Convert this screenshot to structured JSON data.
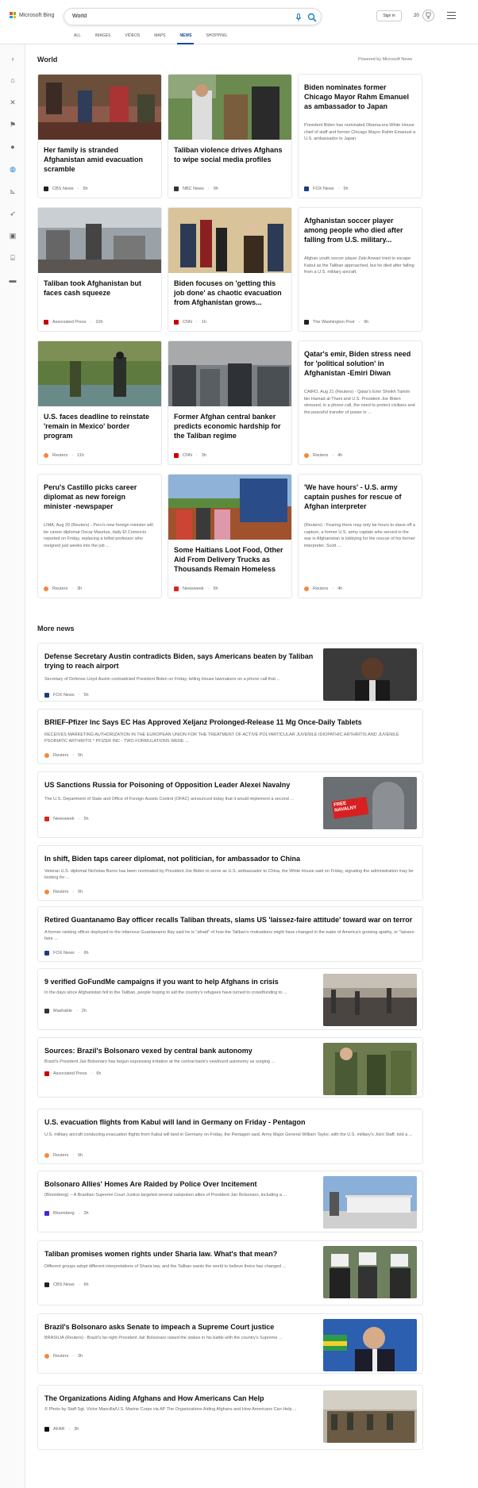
{
  "header": {
    "brand": "Microsoft Bing",
    "search_value": "World",
    "signin_label": "Sign in",
    "points": "20"
  },
  "tabs": [
    {
      "label": "ALL"
    },
    {
      "label": "IMAGES"
    },
    {
      "label": "VIDEOS"
    },
    {
      "label": "MAPS"
    },
    {
      "label": "NEWS"
    },
    {
      "label": "SHOPPING"
    }
  ],
  "sidebar": {
    "icons": [
      "chevron-right-icon",
      "home-icon",
      "tools-icon",
      "flag-icon",
      "location-icon",
      "globe-icon",
      "chart-icon",
      "rocket-icon",
      "film-icon",
      "education-icon",
      "car-icon"
    ]
  },
  "section": {
    "title": "World",
    "powered_by": "Powered by Microsoft News",
    "more_title": "More news"
  },
  "cards": [
    {
      "title": "Her family is stranded Afghanistan amid evacuation scramble",
      "source": "CBS News",
      "time": "5h",
      "desc": ""
    },
    {
      "title": "Taliban violence drives Afghans to wipe social media profiles",
      "source": "NBC News",
      "time": "9h",
      "desc": ""
    },
    {
      "title": "Biden nominates former Chicago Mayor Rahm Emanuel as ambassador to Japan",
      "source": "FOX News",
      "time": "5h",
      "desc": "President Biden has nominated Obama-era White House chief of staff and former Chicago Mayor Rahm Emanuel a U.S. ambassador to Japan."
    },
    {
      "title": "Taliban took Afghanistan but faces cash squeeze",
      "source": "Associated Press",
      "time": "10h",
      "desc": ""
    },
    {
      "title": "Biden focuses on 'getting this job done' as chaotic evacuation from Afghanistan grows...",
      "source": "CNN",
      "time": "1h",
      "desc": ""
    },
    {
      "title": "Afghanistan soccer player among people who died after falling from U.S. military...",
      "source": "The Washington Post",
      "time": "9h",
      "desc": "Afghan youth soccer player Zaki Anwari tried to escape Kabul as the Taliban approached, but he died after falling from a U.S. military aircraft."
    },
    {
      "title": "U.S. faces deadline to reinstate 'remain in Mexico' border program",
      "source": "Reuters",
      "time": "11h",
      "desc": ""
    },
    {
      "title": "Former Afghan central banker predicts economic hardship for the Taliban regime",
      "source": "CNN",
      "time": "3h",
      "desc": ""
    },
    {
      "title": "Qatar's emir, Biden stress need for 'political solution' in Afghanistan -Emiri Diwan",
      "source": "Reuters",
      "time": "4h",
      "desc": "CAIRO, Aug 21 (Reuters) - Qatar's Emir Sheikh Tamim bin Hamad al-Thani and U.S. President Joe Biden stressed, in a phone call, the need to protect civilians and the peaceful transfer of power in ..."
    },
    {
      "title": "Peru's Castillo picks career diplomat as new foreign minister -newspaper",
      "source": "Reuters",
      "time": "3h",
      "desc": "LIMA, Aug 20 (Reuters) - Peru's new foreign minister will be career diplomat Oscar Maurtua, daily El Comercio reported on Friday, replacing a leftist professor who resigned just weeks into the job ..."
    },
    {
      "title": "Some Haitians Loot Food, Other Aid From Delivery Trucks as Thousands Remain Homeless",
      "source": "Newsweek",
      "time": "5h",
      "desc": ""
    },
    {
      "title": "'We have hours' - U.S. army captain pushes for rescue of Afghan interpreter",
      "source": "Reuters",
      "time": "4h",
      "desc": "(Reuters) - Fearing there may only be hours to stave off a capture, a former U.S. army captain who served in the war in Afghanistan is lobbying for the rescue of his former interpreter.     Scott ..."
    }
  ],
  "more_news": [
    {
      "title": "Defense Secretary Austin contradicts Biden, says Americans beaten by Taliban trying to reach airport",
      "desc": "Secretary of Defense Lloyd Austin contradicted President Biden on Friday, telling House lawmakers on a phone call that ...",
      "source": "FOX News",
      "time": "5h"
    },
    {
      "title": "BRIEF-Pfizer Inc Says EC Has Approved Xeljanz Prolonged-Release 11 Mg Once-Daily Tablets",
      "desc": "RECEIVES MARKETING AUTHORIZATION IN THE EUROPEAN UNION FOR THE TREATMENT OF ACTIVE POLYARTICULAR JUVENILE IDIOPATHIC ARTHRITIS AND JUVENILE PSORIATIC ARTHRITIS * PFIZER INC - TWO FORMULATIONS WERE ...",
      "source": "Reuters",
      "time": "5h"
    },
    {
      "title": "US Sanctions Russia for Poisoning of Opposition Leader Alexei Navalny",
      "desc": "The U.S. Department of State and Office of Foreign Assets Control (OFAC) announced today that it would implement a second ...",
      "source": "Newsweek",
      "time": "5h",
      "thumb_text": "FREE NAVALNY"
    },
    {
      "title": "In shift, Biden taps career diplomat, not politician, for ambassador to China",
      "desc": "Veteran U.S. diplomat Nicholas Burns has been nominated by President Joe Biden to serve as U.S. ambassador to China, the White House said on Friday, signaling the administration may be looking for ...",
      "source": "Reuters",
      "time": "6h"
    },
    {
      "title": "Retired Guantanamo Bay officer recalls Taliban threats, slams US 'laissez-faire attitude' toward war on terror",
      "desc": "A former ranking officer deployed to the infamous Guantanamo Bay said he is \"afraid\" of how the Taliban's motivations might have changed in the wake of America's growing apathy, or \"laissez-faire ...",
      "source": "FOX News",
      "time": "6h"
    },
    {
      "title": "9 verified GoFundMe campaigns if you want to help Afghans in crisis",
      "desc": "In the days since Afghanistan fell to the Taliban, people hoping to aid the country's refugees have turned to crowdfunding to ...",
      "source": "Mashable",
      "time": "2h"
    },
    {
      "title": "Sources: Brazil's Bolsonaro vexed by central bank autonomy",
      "desc": "Brazil's President Jair Bolsonaro has begun expressing irritation at the central bank's newfound autonomy as surging ...",
      "source": "Associated Press",
      "time": "6h"
    },
    {
      "title": "U.S. evacuation flights from Kabul will land in Germany on Friday - Pentagon",
      "desc": "U.S. military aircraft conducting evacuation flights from Kabul will land in Germany on Friday, the Pentagon said. Army Major General William Taylor, with the U.S. military's Joint Staff, told a ...",
      "source": "Reuters",
      "time": "6h"
    },
    {
      "title": "Bolsonaro Allies' Homes Are Raided by Police Over Incitement",
      "desc": "(Bloomberg) -- A Brazilian Supreme Court Justice targeted several outspoken allies of President Jair Bolsonaro, including a ...",
      "source": "Bloomberg",
      "time": "3h"
    },
    {
      "title": "Taliban promises women rights under Sharia law. What's that mean?",
      "desc": "Different groups adopt different interpretations of Sharia law, and the Taliban wants the world to believe theirs has changed ...",
      "source": "CBS News",
      "time": "6h"
    },
    {
      "title": "Brazil's Bolsonaro asks Senate to impeach a Supreme Court justice",
      "desc": "BRASILIA (Reuters) - Brazil's far-right President Jair Bolsonaro raised the stakes in his battle with the country's Supreme ...",
      "source": "Reuters",
      "time": "3h"
    },
    {
      "title": "The Organizations Aiding Afghans and How Americans Can Help",
      "desc": "© Photo by Staff Sgt. Victor Mancilla/U.S. Marine Corps via AP The Organizations Aiding Afghans and How Americans Can Help ...",
      "source": "AFAR",
      "time": "3h"
    }
  ],
  "colors": {
    "accent": "#0c4a9c",
    "globe_selected": "#1a7fc1"
  }
}
